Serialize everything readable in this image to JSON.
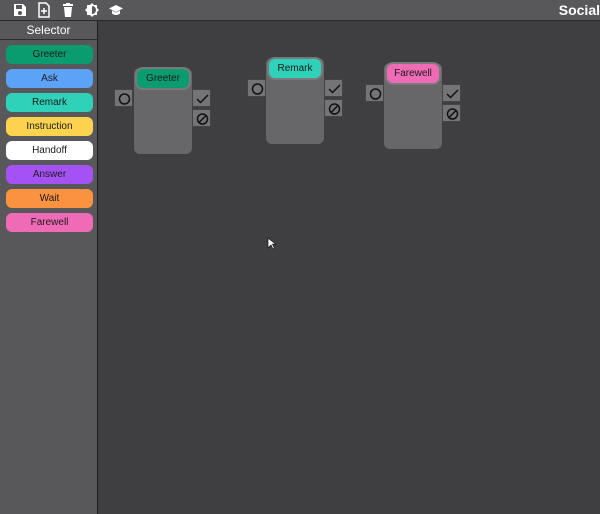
{
  "app": {
    "title": "Social"
  },
  "toolbar": {
    "icons": [
      "save-icon",
      "new-file-icon",
      "delete-icon",
      "theme-toggle-icon",
      "graduation-cap-icon"
    ]
  },
  "sidebar": {
    "header": "Selector",
    "items": [
      {
        "label": "Greeter",
        "color": "#0a9b6e"
      },
      {
        "label": "Ask",
        "color": "#5ca3f7"
      },
      {
        "label": "Remark",
        "color": "#2fd1b9"
      },
      {
        "label": "Instruction",
        "color": "#fbd34f"
      },
      {
        "label": "Handoff",
        "color": "#ffffff"
      },
      {
        "label": "Answer",
        "color": "#a552f5"
      },
      {
        "label": "Wait",
        "color": "#fa9340"
      },
      {
        "label": "Farewell",
        "color": "#f06bb6"
      }
    ]
  },
  "canvas": {
    "nodes": [
      {
        "label": "Greeter",
        "color": "#0a9b6e"
      },
      {
        "label": "Remark",
        "color": "#2fd1b9"
      },
      {
        "label": "Farewell",
        "color": "#f06bb6"
      }
    ]
  }
}
